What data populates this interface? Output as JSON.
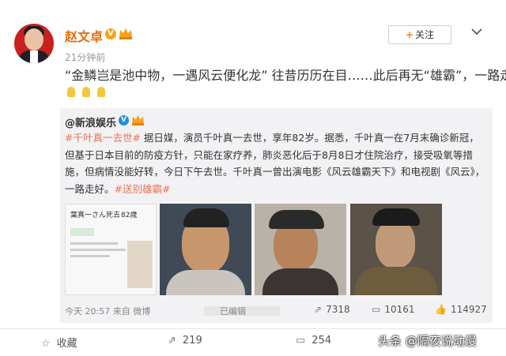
{
  "user": {
    "name": "赵文卓",
    "v_badge": "V",
    "time": "21分钟前",
    "follow_label": "关注",
    "menu_icon": "chevron-down-icon"
  },
  "post": {
    "text": "“金鳞岂是池中物，一遇风云便化龙” 往昔历历在目……此后再无“雄霸”，一路走好",
    "emoji": [
      "pray-icon",
      "pray-icon",
      "pray-icon"
    ]
  },
  "repost": {
    "author": "@新浪娱乐",
    "v_badge": "V",
    "tag1": "#千叶真一去世#",
    "body1": " 据日媒，演员千叶真一去世，享年82岁。据悉，千叶真一在7月末确诊新冠，但基于日本目前的防疫方针，只能在家疗养，肺炎恶化后于8月8日才住院治疗，接受吸氧等措施，但病情没能好转，今日下午去世。千叶真一曾出演电影《风云雄霸天下》和电视剧《风云》，一路走好。",
    "tag2": "#送别雄霸#",
    "thumb1_caption": "葉真一さん死去",
    "thumb1_age": "82歳",
    "time_source": "今天 20:57 来自 微博",
    "edited": "已编辑",
    "reposts": "7318",
    "comments": "10161",
    "likes": "114927"
  },
  "actions": {
    "favorite": "收藏",
    "share": "219",
    "comment": "254"
  },
  "watermark": "头条 @隔夜说动漫",
  "colors": {
    "name": "#e86b0c",
    "tag": "#eb7350",
    "follow_plus": "#ff8200",
    "v_badge": "#f7a21c",
    "repost_bg": "#f2f2f5"
  }
}
